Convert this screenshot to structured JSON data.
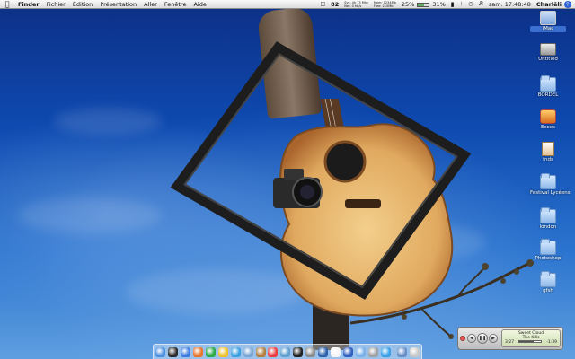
{
  "menubar": {
    "apple_icon": "apple-icon",
    "app_name": "Finder",
    "menus": [
      "Fichier",
      "Édition",
      "Présentation",
      "Aller",
      "Fenêtre",
      "Aide"
    ],
    "status": {
      "sys_text_1": "Sys: 4h 13 Mhz",
      "sys_text_2": "Net: 0 kb/s",
      "temp": "82",
      "mem_text_1": "Mem: 1234Mb",
      "mem_text_2": "Free: 210Mb",
      "cpu_percent": "25%",
      "battery_percent": "31%",
      "clock": "sam. 17:48:48",
      "user": "Charlēli"
    }
  },
  "desktop": {
    "icons": [
      {
        "label": "iMac",
        "icon": "imac-icon"
      },
      {
        "label": "Untitled",
        "icon": "hard-drive-icon"
      },
      {
        "label": "BORDEL",
        "icon": "folder-icon"
      },
      {
        "label": "Exces",
        "icon": "application-icon"
      },
      {
        "label": "fnds",
        "icon": "document-icon"
      },
      {
        "label": "Festival Lycéens",
        "icon": "folder-icon"
      },
      {
        "label": "london",
        "icon": "folder-icon"
      },
      {
        "label": "Photoshop",
        "icon": "folder-icon"
      },
      {
        "label": "gfsh",
        "icon": "folder-icon"
      }
    ]
  },
  "mini_player": {
    "song": "Sweet Cloud",
    "artist": "The Kills",
    "elapsed": "3:27",
    "remaining": "-1:39",
    "progress": 0.67
  },
  "dock": {
    "items": [
      "finder-icon",
      "dashboard-icon",
      "safari-icon",
      "firefox-icon",
      "itunes-icon",
      "iphoto-icon",
      "ichat-icon",
      "mail-icon",
      "address-book-icon",
      "calendar-icon",
      "preview-icon",
      "terminal-icon",
      "system-preferences-icon",
      "photoshop-icon",
      "textedit-icon",
      "quicktime-icon",
      "folder-icon",
      "network-icon",
      "app-store-icon",
      "downloads-icon",
      "trash-icon"
    ]
  },
  "colors": {
    "sky_dark": "#0d2f86",
    "sky_light": "#5f9fe0",
    "guitar_wood": "#e6b66d",
    "menubar_bg": "#f0f0f0"
  }
}
